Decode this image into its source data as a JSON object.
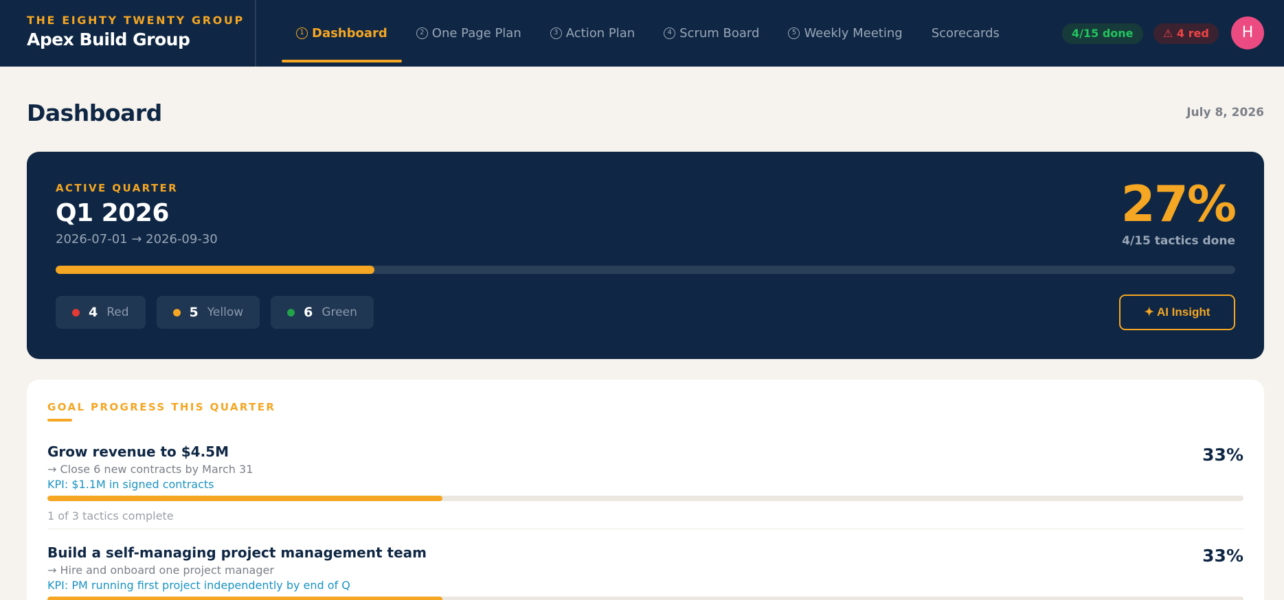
{
  "brand": {
    "eyebrow": "THE EIGHTY TWENTY GROUP",
    "name": "Apex Build Group"
  },
  "nav": [
    {
      "num": "1",
      "label": "Dashboard",
      "active": true
    },
    {
      "num": "2",
      "label": "One Page Plan"
    },
    {
      "num": "3",
      "label": "Action Plan"
    },
    {
      "num": "4",
      "label": "Scrum Board"
    },
    {
      "num": "5",
      "label": "Weekly Meeting"
    },
    {
      "num": "",
      "label": "Scorecards"
    }
  ],
  "header_badges": {
    "done": "4/15 done",
    "red": "⚠ 4 red"
  },
  "user": {
    "avatar_initial": "H",
    "avatar_color": "#ec4b82"
  },
  "page": {
    "title": "Dashboard",
    "date": "July 8, 2026"
  },
  "quarter": {
    "eyebrow": "ACTIVE QUARTER",
    "title": "Q1 2026",
    "range": "2026-07-01 → 2026-09-30",
    "percent_label": "27%",
    "progress": 0.27,
    "tactics_done": "4/15 tactics done",
    "statuses": [
      {
        "count": "4",
        "label": "Red",
        "color": "#e53935"
      },
      {
        "count": "5",
        "label": "Yellow",
        "color": "#f5a623"
      },
      {
        "count": "6",
        "label": "Green",
        "color": "#22a34a"
      }
    ],
    "ai_button": "✦ AI Insight"
  },
  "goals": {
    "heading": "GOAL PROGRESS THIS QUARTER",
    "items": [
      {
        "title": "Grow revenue to $4.5M",
        "objective": "→ Close 6 new contracts by March 31",
        "kpi": "KPI: $1.1M in signed contracts",
        "percent_label": "33%",
        "progress": 0.33,
        "tactics": "1 of 3 tactics complete"
      },
      {
        "title": "Build a self-managing project management team",
        "objective": "→ Hire and onboard one project manager",
        "kpi": "KPI: PM running first project independently by end of Q",
        "percent_label": "33%",
        "progress": 0.33,
        "tactics": ""
      }
    ]
  },
  "colors": {
    "navy": "#0f2744",
    "accent": "#f5a623",
    "background": "#f6f3ee",
    "kpi_blue": "#1b93c4"
  }
}
